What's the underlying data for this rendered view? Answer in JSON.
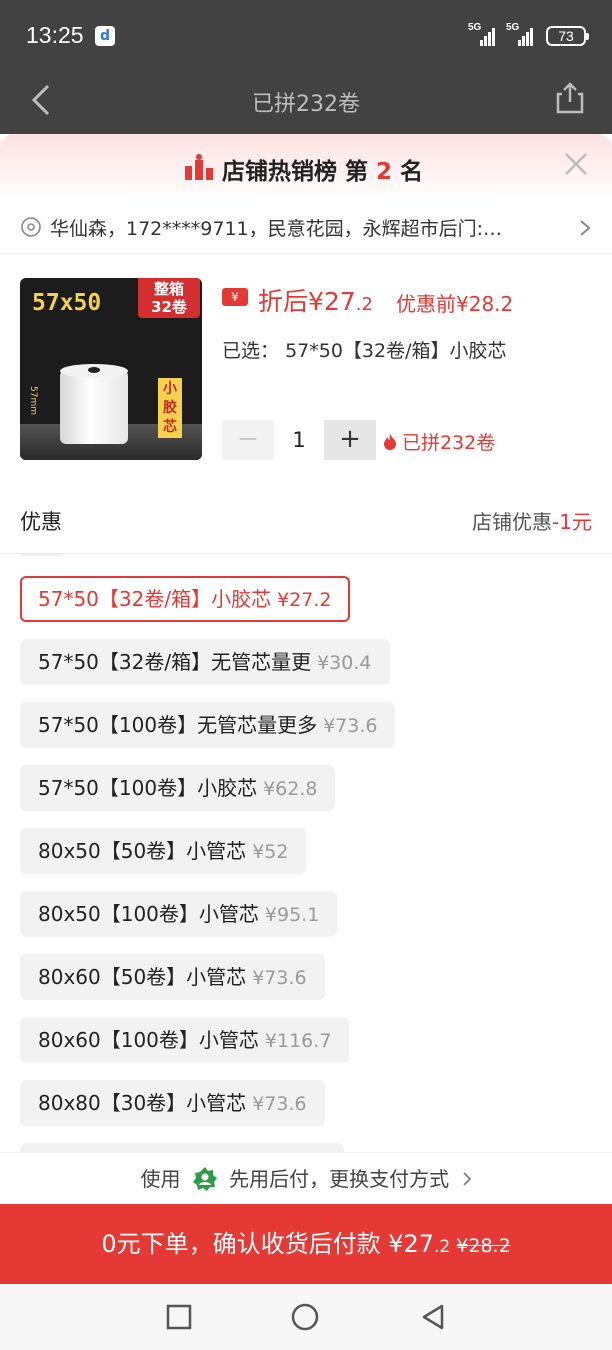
{
  "status_bar": {
    "time": "13:25",
    "app_badge": "d",
    "signal_1": "5G",
    "signal_2": "5G",
    "battery": "73"
  },
  "nav": {
    "title": "已拼232卷"
  },
  "banner": {
    "prefix": "店铺热销榜 第 ",
    "rank": "2",
    "suffix": " 名"
  },
  "address": {
    "text": "华仙森，172****9711，民意花园，永辉超市后门:…"
  },
  "product": {
    "image": {
      "size_label": "57x50",
      "box_line1": "整箱",
      "box_line2": "32卷",
      "dimension": "57mm",
      "core_label": "小胶芯"
    },
    "coupon_icon": "¥",
    "price_after_label": "折后¥27",
    "price_after_decimal": ".2",
    "price_before": "优惠前¥28.2",
    "selected_label": "已选：",
    "selected_value": "57*50【32卷/箱】小胶芯",
    "stepper": {
      "minus": "−",
      "quantity": "1",
      "plus": "+"
    },
    "joined": "已拼232卷"
  },
  "discount": {
    "label": "优惠",
    "value_prefix": "店铺优惠",
    "value_amount": "-1元"
  },
  "options": [
    {
      "label": "57*50【32卷/箱】小胶芯",
      "price": "¥27.2",
      "selected": true
    },
    {
      "label": "57*50【32卷/箱】无管芯量更",
      "price": "¥30.4",
      "selected": false
    },
    {
      "label": "57*50【100卷】无管芯量更多",
      "price": "¥73.6",
      "selected": false
    },
    {
      "label": "57*50【100卷】小胶芯",
      "price": "¥62.8",
      "selected": false
    },
    {
      "label": "80x50【50卷】小管芯",
      "price": "¥52",
      "selected": false
    },
    {
      "label": "80x50【100卷】小管芯",
      "price": "¥95.1",
      "selected": false
    },
    {
      "label": "80x60【50卷】小管芯",
      "price": "¥73.6",
      "selected": false
    },
    {
      "label": "80x60【100卷】小管芯",
      "price": "¥116.7",
      "selected": false
    },
    {
      "label": "80x80【30卷】小管芯",
      "price": "¥73.6",
      "selected": false
    }
  ],
  "payment": {
    "prefix": "使用",
    "text": "先用后付，更换支付方式"
  },
  "submit": {
    "main": "0元下单，确认收货后付款 ¥27",
    "decimal": ".2",
    "original": "¥28.2"
  },
  "colors": {
    "accent": "#e53935",
    "header_bg": "#424242",
    "option_bg": "#f2f2f2"
  }
}
